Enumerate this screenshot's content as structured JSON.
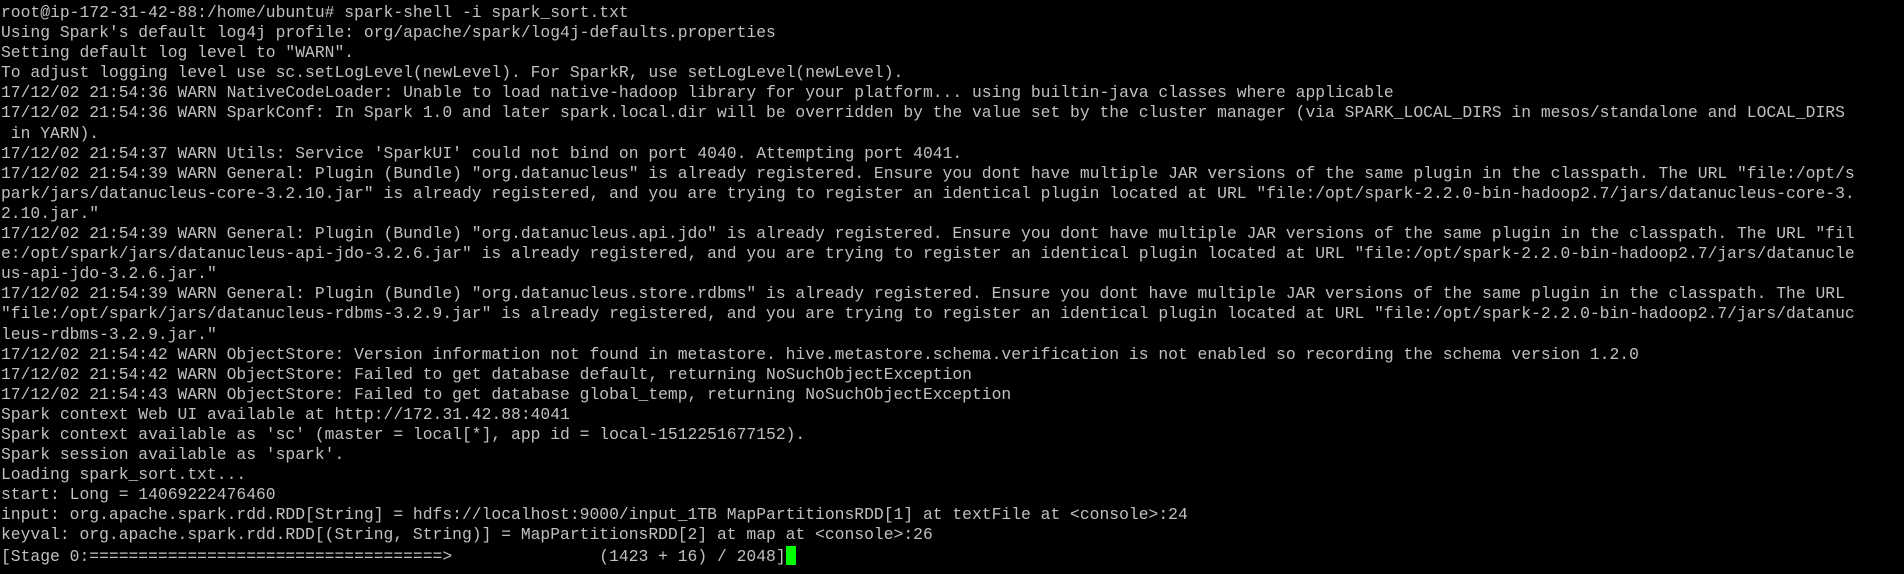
{
  "terminal": {
    "cursor_color": "#00ff00",
    "text_color": "#c0c0c0",
    "background_color": "#000000",
    "lines": [
      "root@ip-172-31-42-88:/home/ubuntu# spark-shell -i spark_sort.txt",
      "Using Spark's default log4j profile: org/apache/spark/log4j-defaults.properties",
      "Setting default log level to \"WARN\".",
      "To adjust logging level use sc.setLogLevel(newLevel). For SparkR, use setLogLevel(newLevel).",
      "17/12/02 21:54:36 WARN NativeCodeLoader: Unable to load native-hadoop library for your platform... using builtin-java classes where applicable",
      "17/12/02 21:54:36 WARN SparkConf: In Spark 1.0 and later spark.local.dir will be overridden by the value set by the cluster manager (via SPARK_LOCAL_DIRS in mesos/standalone and LOCAL_DIRS",
      " in YARN).",
      "17/12/02 21:54:37 WARN Utils: Service 'SparkUI' could not bind on port 4040. Attempting port 4041.",
      "17/12/02 21:54:39 WARN General: Plugin (Bundle) \"org.datanucleus\" is already registered. Ensure you dont have multiple JAR versions of the same plugin in the classpath. The URL \"file:/opt/s",
      "park/jars/datanucleus-core-3.2.10.jar\" is already registered, and you are trying to register an identical plugin located at URL \"file:/opt/spark-2.2.0-bin-hadoop2.7/jars/datanucleus-core-3.",
      "2.10.jar.\"",
      "17/12/02 21:54:39 WARN General: Plugin (Bundle) \"org.datanucleus.api.jdo\" is already registered. Ensure you dont have multiple JAR versions of the same plugin in the classpath. The URL \"fil",
      "e:/opt/spark/jars/datanucleus-api-jdo-3.2.6.jar\" is already registered, and you are trying to register an identical plugin located at URL \"file:/opt/spark-2.2.0-bin-hadoop2.7/jars/datanucle",
      "us-api-jdo-3.2.6.jar.\"",
      "17/12/02 21:54:39 WARN General: Plugin (Bundle) \"org.datanucleus.store.rdbms\" is already registered. Ensure you dont have multiple JAR versions of the same plugin in the classpath. The URL",
      "\"file:/opt/spark/jars/datanucleus-rdbms-3.2.9.jar\" is already registered, and you are trying to register an identical plugin located at URL \"file:/opt/spark-2.2.0-bin-hadoop2.7/jars/datanuc",
      "leus-rdbms-3.2.9.jar.\"",
      "17/12/02 21:54:42 WARN ObjectStore: Version information not found in metastore. hive.metastore.schema.verification is not enabled so recording the schema version 1.2.0",
      "17/12/02 21:54:42 WARN ObjectStore: Failed to get database default, returning NoSuchObjectException",
      "17/12/02 21:54:43 WARN ObjectStore: Failed to get database global_temp, returning NoSuchObjectException",
      "Spark context Web UI available at http://172.31.42.88:4041",
      "Spark context available as 'sc' (master = local[*], app id = local-1512251677152).",
      "Spark session available as 'spark'.",
      "Loading spark_sort.txt...",
      "start: Long = 14069222476460",
      "input: org.apache.spark.rdd.RDD[String] = hdfs://localhost:9000/input_1TB MapPartitionsRDD[1] at textFile at <console>:24",
      "keyval: org.apache.spark.rdd.RDD[(String, String)] = MapPartitionsRDD[2] at map at <console>:26",
      "[Stage 0:====================================>               (1423 + 16) / 2048]"
    ]
  }
}
